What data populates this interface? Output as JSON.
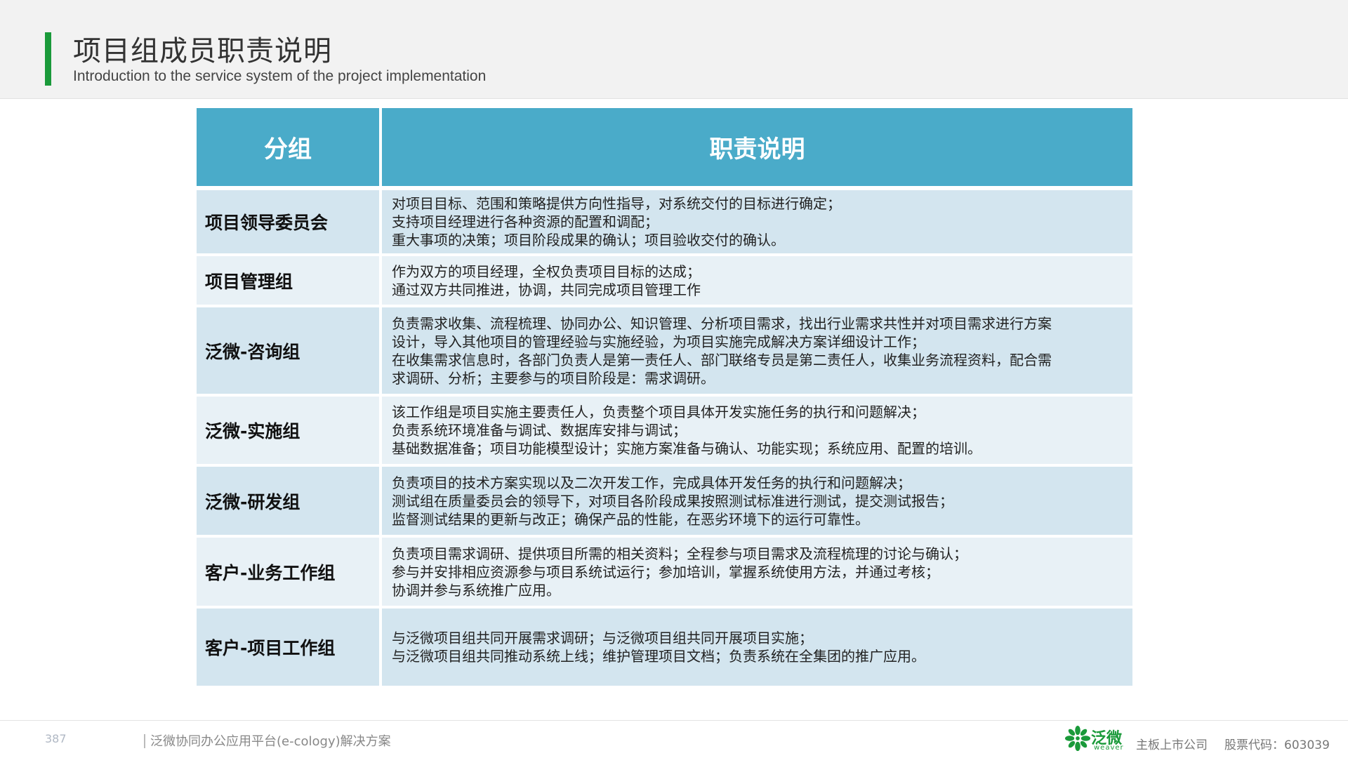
{
  "header": {
    "title": "项目组成员职责说明",
    "subtitle": "Introduction to the service system of the project implementation"
  },
  "table": {
    "columns": [
      "分组",
      "职责说明"
    ],
    "rows": [
      {
        "group": "项目领导委员会",
        "lines": [
          "对项目目标、范围和策略提供方向性指导，对系统交付的目标进行确定；",
          "支持项目经理进行各种资源的配置和调配；",
          "重大事项的决策；项目阶段成果的确认；项目验收交付的确认。"
        ]
      },
      {
        "group": "项目管理组",
        "lines": [
          "作为双方的项目经理，全权负责项目目标的达成；",
          "通过双方共同推进，协调，共同完成项目管理工作"
        ]
      },
      {
        "group": "泛微-咨询组",
        "lines": [
          "负责需求收集、流程梳理、协同办公、知识管理、分析项目需求，找出行业需求共性并对项目需求进行方案",
          "设计，导入其他项目的管理经验与实施经验，为项目实施完成解决方案详细设计工作；",
          "在收集需求信息时，各部门负责人是第一责任人、部门联络专员是第二责任人，收集业务流程资料，配合需",
          "求调研、分析；主要参与的项目阶段是：需求调研。"
        ]
      },
      {
        "group": "泛微-实施组",
        "lines": [
          "该工作组是项目实施主要责任人，负责整个项目具体开发实施任务的执行和问题解决；",
          "负责系统环境准备与调试、数据库安排与调试；",
          "基础数据准备；项目功能模型设计；实施方案准备与确认、功能实现；系统应用、配置的培训。"
        ]
      },
      {
        "group": "泛微-研发组",
        "lines": [
          "负责项目的技术方案实现以及二次开发工作，完成具体开发任务的执行和问题解决；",
          "测试组在质量委员会的领导下，对项目各阶段成果按照测试标准进行测试，提交测试报告；",
          "监督测试结果的更新与改正；确保产品的性能，在恶劣环境下的运行可靠性。"
        ]
      },
      {
        "group": "客户-业务工作组",
        "lines": [
          "负责项目需求调研、提供项目所需的相关资料；全程参与项目需求及流程梳理的讨论与确认；",
          "参与并安排相应资源参与项目系统试运行；参加培训，掌握系统使用方法，并通过考核；",
          "协调并参与系统推广应用。"
        ]
      },
      {
        "group": "客户-项目工作组",
        "lines": [
          "与泛微项目组共同开展需求调研；与泛微项目组共同开展项目实施；",
          "与泛微项目组共同推动系统上线；维护管理项目文档；负责系统在全集团的推广应用。"
        ]
      }
    ]
  },
  "footer": {
    "page_number": "387",
    "doc_title": "泛微协同办公应用平台(e-cology)解决方案",
    "logo_cn": "泛微",
    "logo_en": "weaver",
    "company_status": "主板上市公司",
    "stock_code": "股票代码：603039"
  },
  "colors": {
    "accent_green": "#1a9a3a",
    "table_header": "#4aabc9",
    "row_shade_dark": "#d3e5ef",
    "row_shade_light": "#e8f1f6"
  }
}
